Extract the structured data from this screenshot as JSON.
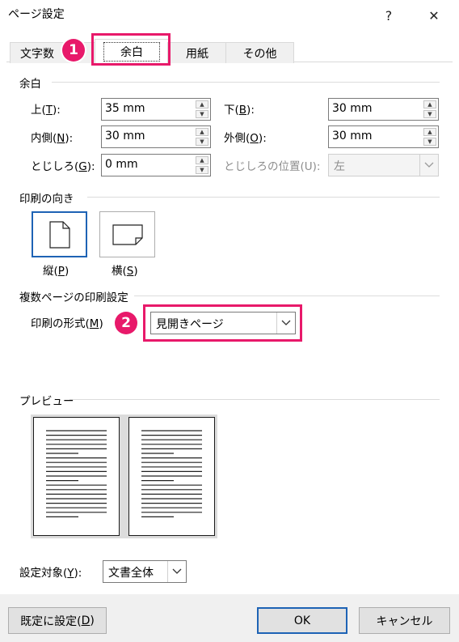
{
  "window": {
    "title": "ページ設定",
    "help_glyph": "?",
    "close_glyph": "✕"
  },
  "tabs": [
    {
      "label": "文字数"
    },
    {
      "label": "余白"
    },
    {
      "label": "用紙"
    },
    {
      "label": "その他"
    }
  ],
  "badges": {
    "one": "1",
    "two": "2"
  },
  "margins": {
    "section_title": "余白",
    "top": {
      "label_pre": "上(",
      "key": "T",
      "label_post": "):",
      "value": "35 mm"
    },
    "bottom": {
      "label_pre": "下(",
      "key": "B",
      "label_post": "):",
      "value": "30 mm"
    },
    "inside": {
      "label_pre": "内側(",
      "key": "N",
      "label_post": "):",
      "value": "30 mm"
    },
    "outside": {
      "label_pre": "外側(",
      "key": "O",
      "label_post": "):",
      "value": "30 mm"
    },
    "gutter": {
      "label_pre": "とじしろ(",
      "key": "G",
      "label_post": "):",
      "value": "0 mm"
    },
    "gutter_position": {
      "label": "とじしろの位置(U):",
      "value": "左"
    }
  },
  "orientation": {
    "section_title": "印刷の向き",
    "portrait": {
      "label_pre": "縦(",
      "key": "P",
      "label_post": ")"
    },
    "landscape": {
      "label_pre": "横(",
      "key": "S",
      "label_post": ")"
    }
  },
  "multiple_pages": {
    "section_title": "複数ページの印刷設定",
    "label_pre": "印刷の形式(",
    "key": "M",
    "label_post": ")",
    "value": "見開きページ"
  },
  "preview": {
    "section_title": "プレビュー"
  },
  "apply_to": {
    "label_pre": "設定対象(",
    "key": "Y",
    "label_post": "):",
    "value": "文書全体"
  },
  "footer": {
    "default_pre": "既定に設定(",
    "default_key": "D",
    "default_post": ")",
    "ok": "OK",
    "cancel": "キャンセル"
  },
  "colors": {
    "highlight": "#e8196a",
    "focus_blue": "#1e63b5"
  }
}
